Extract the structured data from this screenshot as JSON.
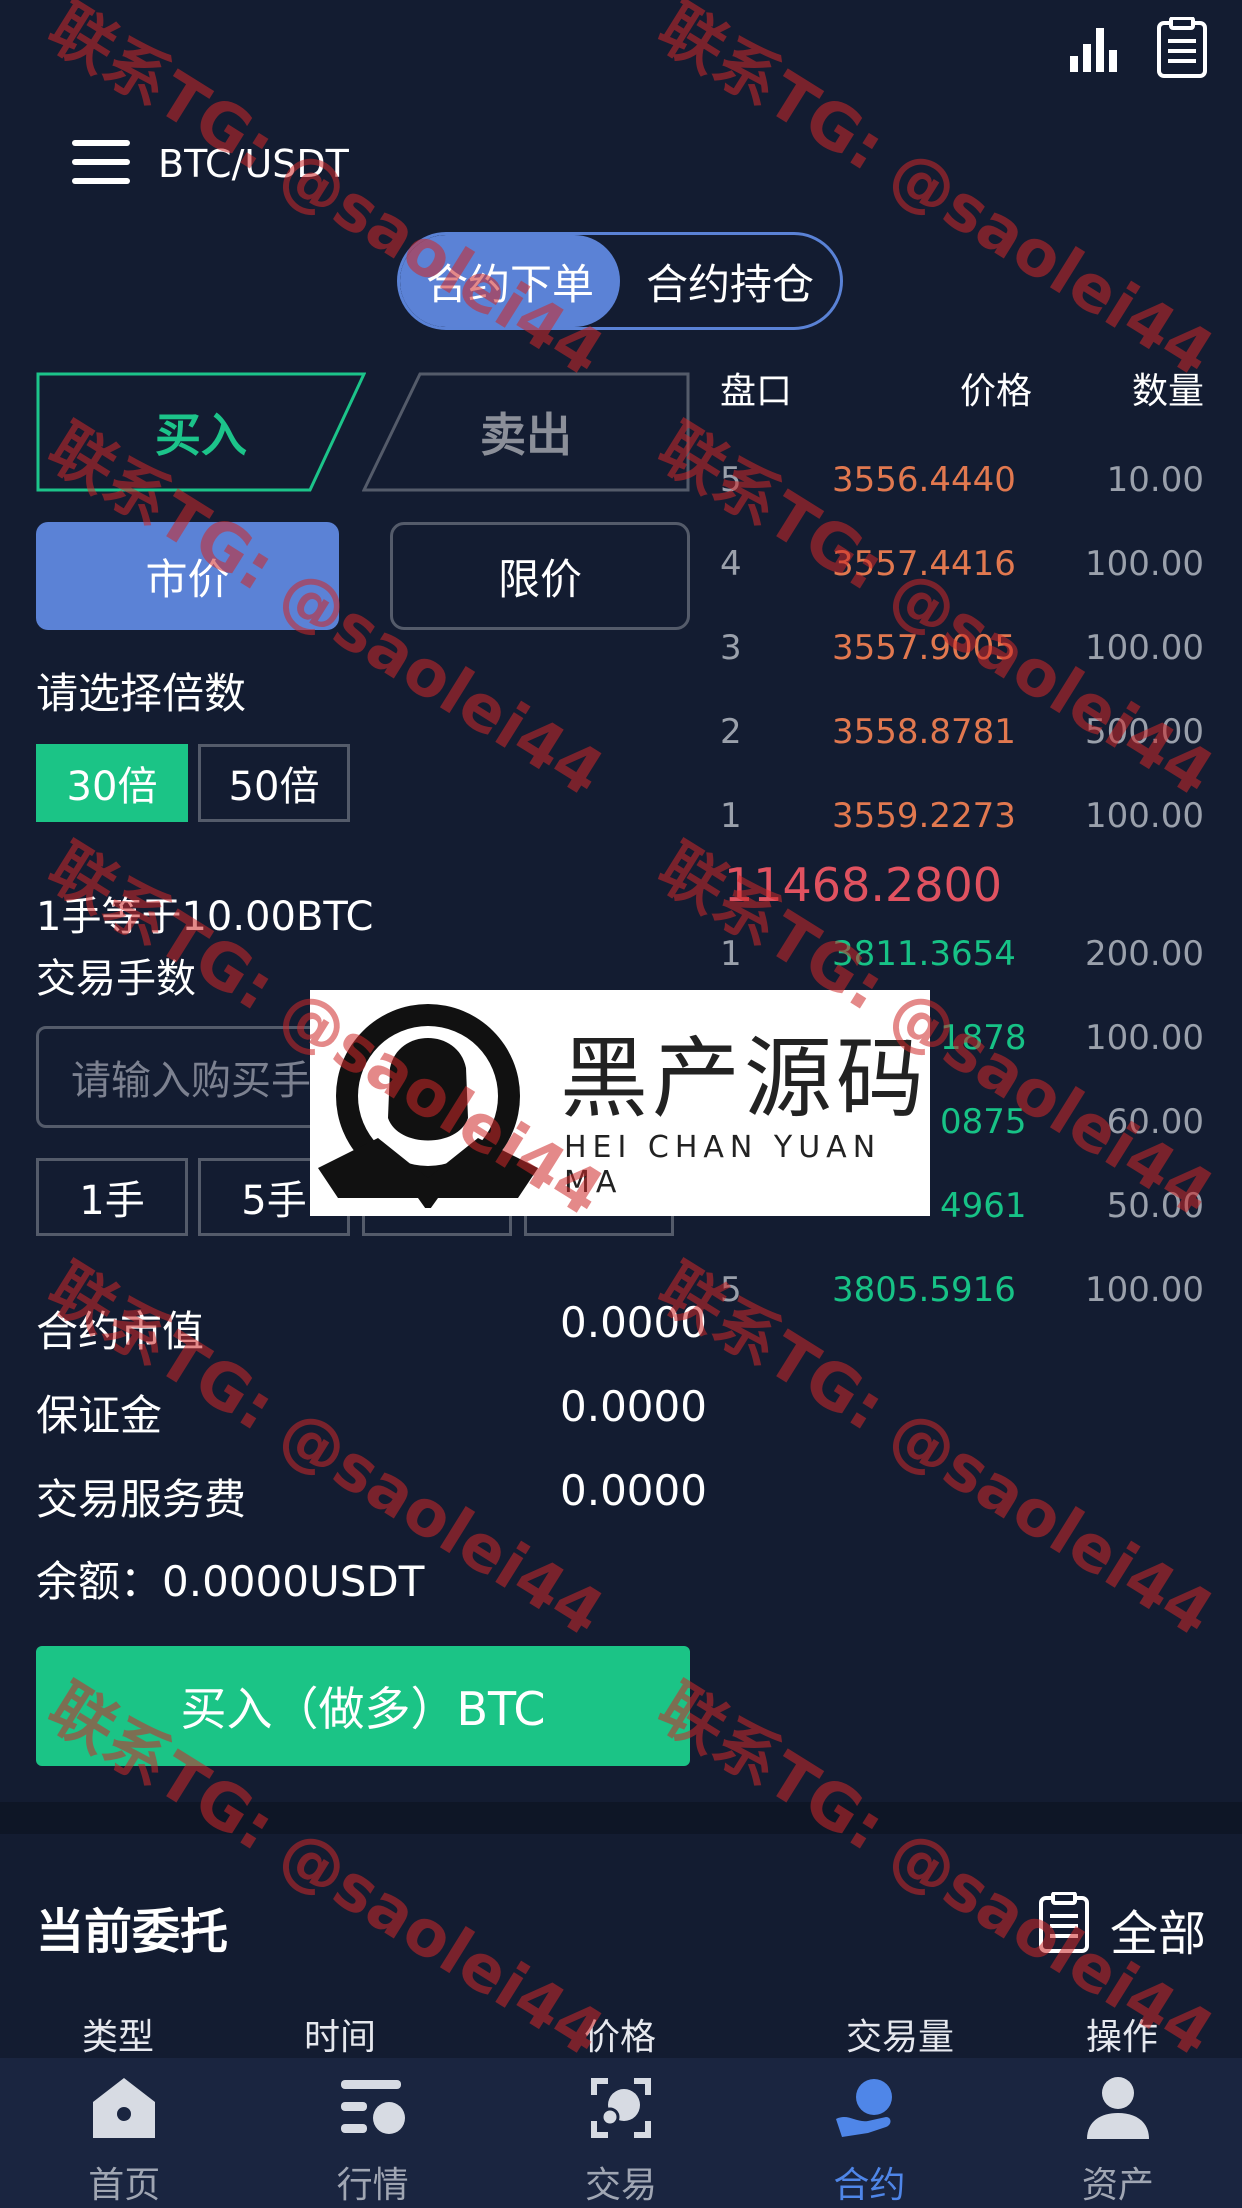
{
  "header": {
    "pair": "BTC/USDT"
  },
  "segment": {
    "tabs": [
      "合约下单",
      "合约持仓"
    ],
    "active": 0
  },
  "side_tabs": {
    "buy": "买入",
    "sell": "卖出"
  },
  "order_type": {
    "market": "市价",
    "limit": "限价"
  },
  "leverage": {
    "label": "请选择倍数",
    "options": [
      "30倍",
      "50倍"
    ],
    "selected": 0
  },
  "lot_info": "1手等于10.00BTC",
  "trade_qty": {
    "label": "交易手数",
    "placeholder": "请输入购买手"
  },
  "lot_buttons": [
    "1手",
    "5手"
  ],
  "summary": {
    "contract_value_label": "合约市值",
    "contract_value": "0.0000",
    "margin_label": "保证金",
    "margin": "0.0000",
    "fee_label": "交易服务费",
    "fee": "0.0000",
    "balance": "余额：0.0000USDT"
  },
  "buy_button": "买入（做多）BTC",
  "orderbook": {
    "headers": {
      "level": "盘口",
      "price": "价格",
      "qty": "数量"
    },
    "asks": [
      {
        "level": "5",
        "price": "3556.4440",
        "qty": "10.00"
      },
      {
        "level": "4",
        "price": "3557.4416",
        "qty": "100.00"
      },
      {
        "level": "3",
        "price": "3557.9005",
        "qty": "100.00"
      },
      {
        "level": "2",
        "price": "3558.8781",
        "qty": "500.00"
      },
      {
        "level": "1",
        "price": "3559.2273",
        "qty": "100.00"
      }
    ],
    "last_price": "11468.2800",
    "bids": [
      {
        "level": "1",
        "price": "3811.3654",
        "qty": "200.00"
      },
      {
        "level": "",
        "price": "1878",
        "qty": "100.00"
      },
      {
        "level": "",
        "price": "0875",
        "qty": "60.00"
      },
      {
        "level": "",
        "price": "4961",
        "qty": "50.00"
      },
      {
        "level": "5",
        "price": "3805.5916",
        "qty": "100.00"
      }
    ]
  },
  "orders": {
    "title": "当前委托",
    "all": "全部",
    "columns": [
      "类型",
      "时间",
      "价格",
      "交易量",
      "操作"
    ]
  },
  "nav": {
    "items": [
      "首页",
      "行情",
      "交易",
      "合约",
      "资产"
    ],
    "active": 3
  },
  "logo": {
    "cn": "黑产源码",
    "en": "HEI CHAN YUAN MA"
  },
  "watermark": "联系TG: @saolei44",
  "colors": {
    "background": "#131c31",
    "accent": "#5b82d6",
    "buy": "#1bc486",
    "ask": "#e1784f",
    "last": "#e05260"
  }
}
